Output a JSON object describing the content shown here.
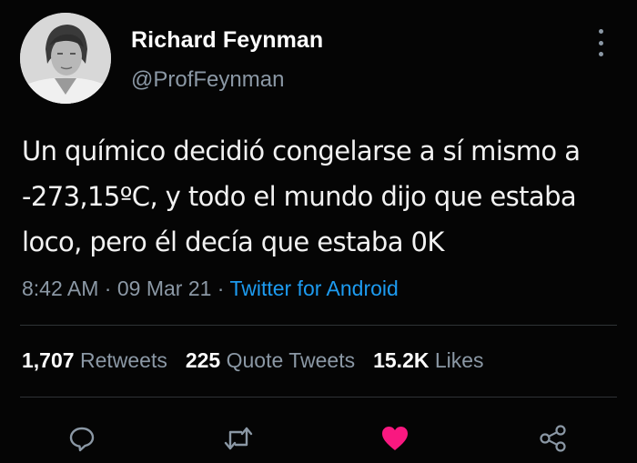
{
  "author": {
    "name": "Richard Feynman",
    "handle": "@ProfFeynman"
  },
  "tweet": {
    "lines": [
      "Un químico decidió congelarse a sí mismo a",
      "-273,15ºC, y todo el mundo dijo que estaba",
      "loco, pero él decía que estaba 0K"
    ]
  },
  "meta": {
    "time": "8:42 AM",
    "separator": " · ",
    "date": "09 Mar 21",
    "source": "Twitter for Android"
  },
  "stats": {
    "retweets_count": "1,707",
    "retweets_label": "Retweets",
    "quotes_count": "225",
    "quotes_label": "Quote Tweets",
    "likes_count": "15.2K",
    "likes_label": "Likes"
  },
  "colors": {
    "background": "#050505",
    "muted": "#8b98a5",
    "link": "#1d9bf0",
    "like": "#f91880"
  },
  "icons": [
    "more-icon",
    "reply-icon",
    "retweet-icon",
    "like-icon",
    "share-icon"
  ]
}
